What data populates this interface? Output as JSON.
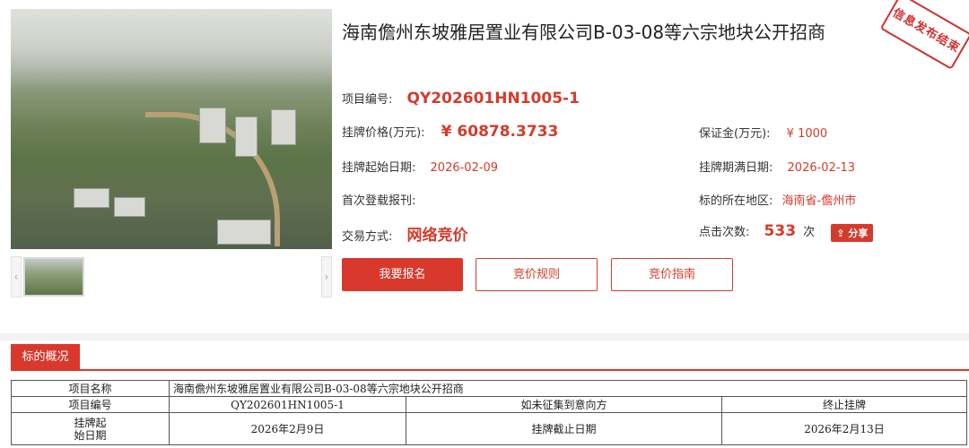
{
  "title": "海南儋州东坡雅居置业有限公司B-03-08等六宗地块公开招商",
  "stamp": "信息发布结束",
  "fields": {
    "project_no_label": "项目编号:",
    "project_no": "QY202601HN1005-1",
    "price_label": "挂牌价格(万元):",
    "price": "¥ 60878.3733",
    "deposit_label": "保证金(万元):",
    "deposit": "¥ 1000",
    "start_label": "挂牌起始日期:",
    "start_date": "2026-02-09",
    "end_label": "挂牌期满日期:",
    "end_date": "2026-02-13",
    "publish_label": "首次登载报刊:",
    "publish_value": "",
    "region_label": "标的所在地区:",
    "region": "海南省-儋州市",
    "method_label": "交易方式:",
    "method": "网络竞价",
    "clicks_label": "点击次数:",
    "clicks": "533",
    "clicks_unit": "次",
    "share": "分享"
  },
  "buttons": {
    "register": "我要报名",
    "rules": "竞价规则",
    "guide": "竞价指南"
  },
  "thumb_arrows": {
    "prev": "‹",
    "next": "›"
  },
  "section": {
    "tab": "标的概况",
    "table": {
      "r1": {
        "label": "项目名称",
        "value": "海南儋州东坡雅居置业有限公司B-03-08等六宗地块公开招商"
      },
      "r2": {
        "label": "项目编号",
        "value": "QY202601HN1005-1",
        "label2": "如未征集到意向方",
        "value2": "终止挂牌"
      },
      "r3": {
        "label_line1": "挂牌起",
        "label_line2": "始日期",
        "value": "2026年2月9日",
        "label2": "挂牌截止日期",
        "value2": "2026年2月13日"
      }
    }
  },
  "colors": {
    "accent": "#d9392c"
  }
}
